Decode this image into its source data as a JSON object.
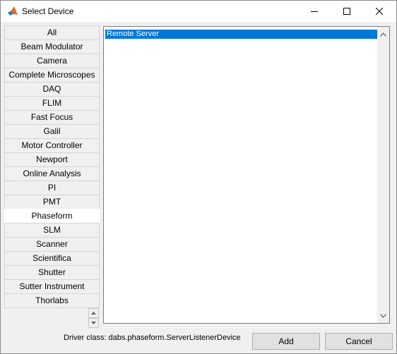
{
  "window": {
    "title": "Select Device"
  },
  "categories": [
    "All",
    "Beam Modulator",
    "Camera",
    "Complete Microscopes",
    "DAQ",
    "FLIM",
    "Fast Focus",
    "Galil",
    "Motor Controller",
    "Newport",
    "Online Analysis",
    "PI",
    "PMT",
    "Phaseform",
    "SLM",
    "Scanner",
    "Scientifica",
    "Shutter",
    "Sutter Instrument",
    "Thorlabs"
  ],
  "selected_category": "Phaseform",
  "devices": [
    "Remote Server"
  ],
  "selected_device": "Remote Server",
  "driver_class": "Driver class: dabs.phaseform.ServerListenerDevice",
  "buttons": {
    "add": "Add",
    "cancel": "Cancel"
  },
  "colors": {
    "selection": "#0078d7"
  }
}
